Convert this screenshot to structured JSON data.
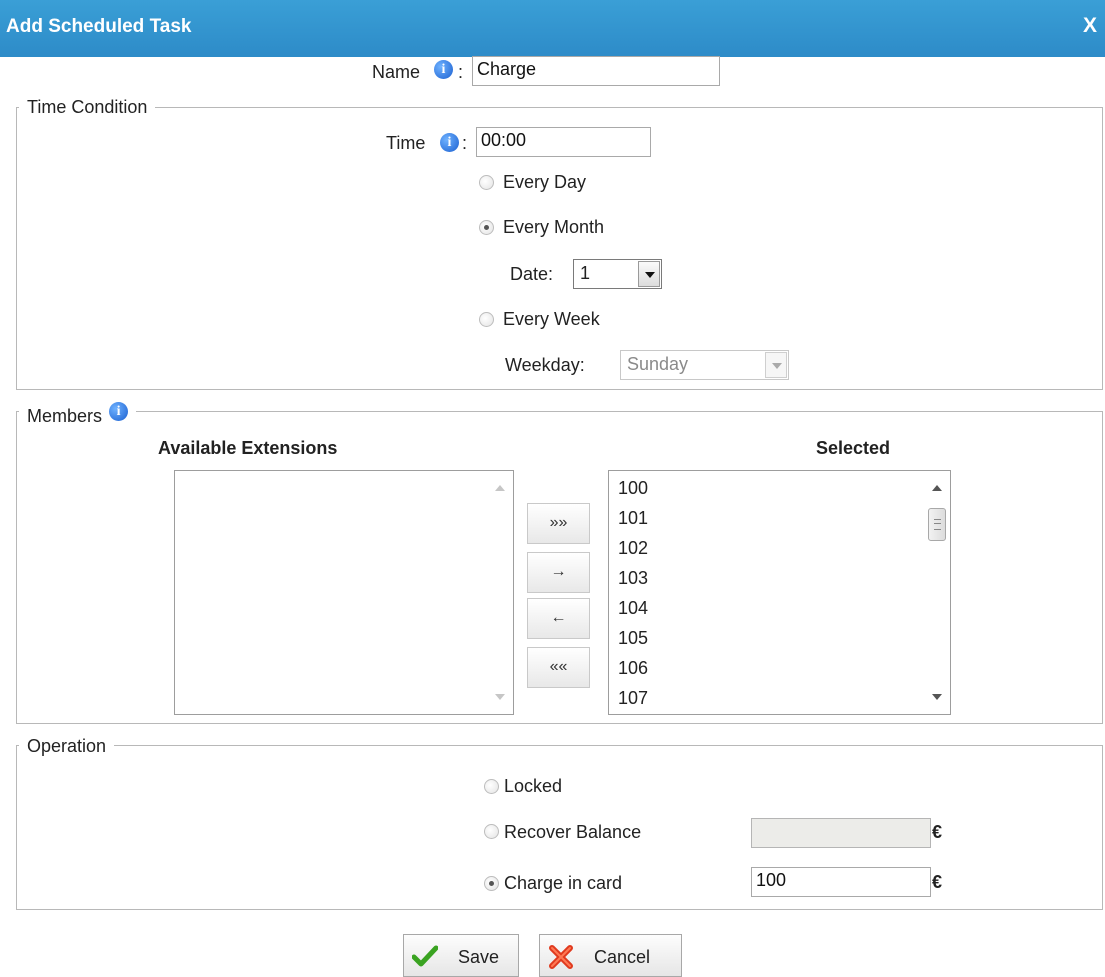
{
  "dialog": {
    "title": "Add Scheduled Task",
    "close_label": "X"
  },
  "name_field": {
    "label": "Name",
    "colon": ":",
    "value": "Charge"
  },
  "time_condition": {
    "legend": "Time Condition",
    "time_label": "Time",
    "time_colon": ":",
    "time_value": "00:00",
    "every_day": "Every Day",
    "every_month": "Every Month",
    "date_label": "Date:",
    "date_value": "1",
    "every_week": "Every Week",
    "weekday_label": "Weekday:",
    "weekday_value": "Sunday",
    "selected": "every_month"
  },
  "members": {
    "legend": "Members",
    "available_header": "Available Extensions",
    "selected_header": "Selected",
    "available": [],
    "selected": [
      "100",
      "101",
      "102",
      "103",
      "104",
      "105",
      "106",
      "107"
    ],
    "buttons": {
      "add_all": "»»",
      "add": "→",
      "remove": "←",
      "remove_all": "««"
    }
  },
  "operation": {
    "legend": "Operation",
    "locked": "Locked",
    "recover_balance": "Recover Balance",
    "recover_value": "",
    "charge_in_card": "Charge in card",
    "charge_value": "100",
    "currency": "€",
    "selected": "charge_in_card"
  },
  "actions": {
    "save": "Save",
    "cancel": "Cancel"
  }
}
